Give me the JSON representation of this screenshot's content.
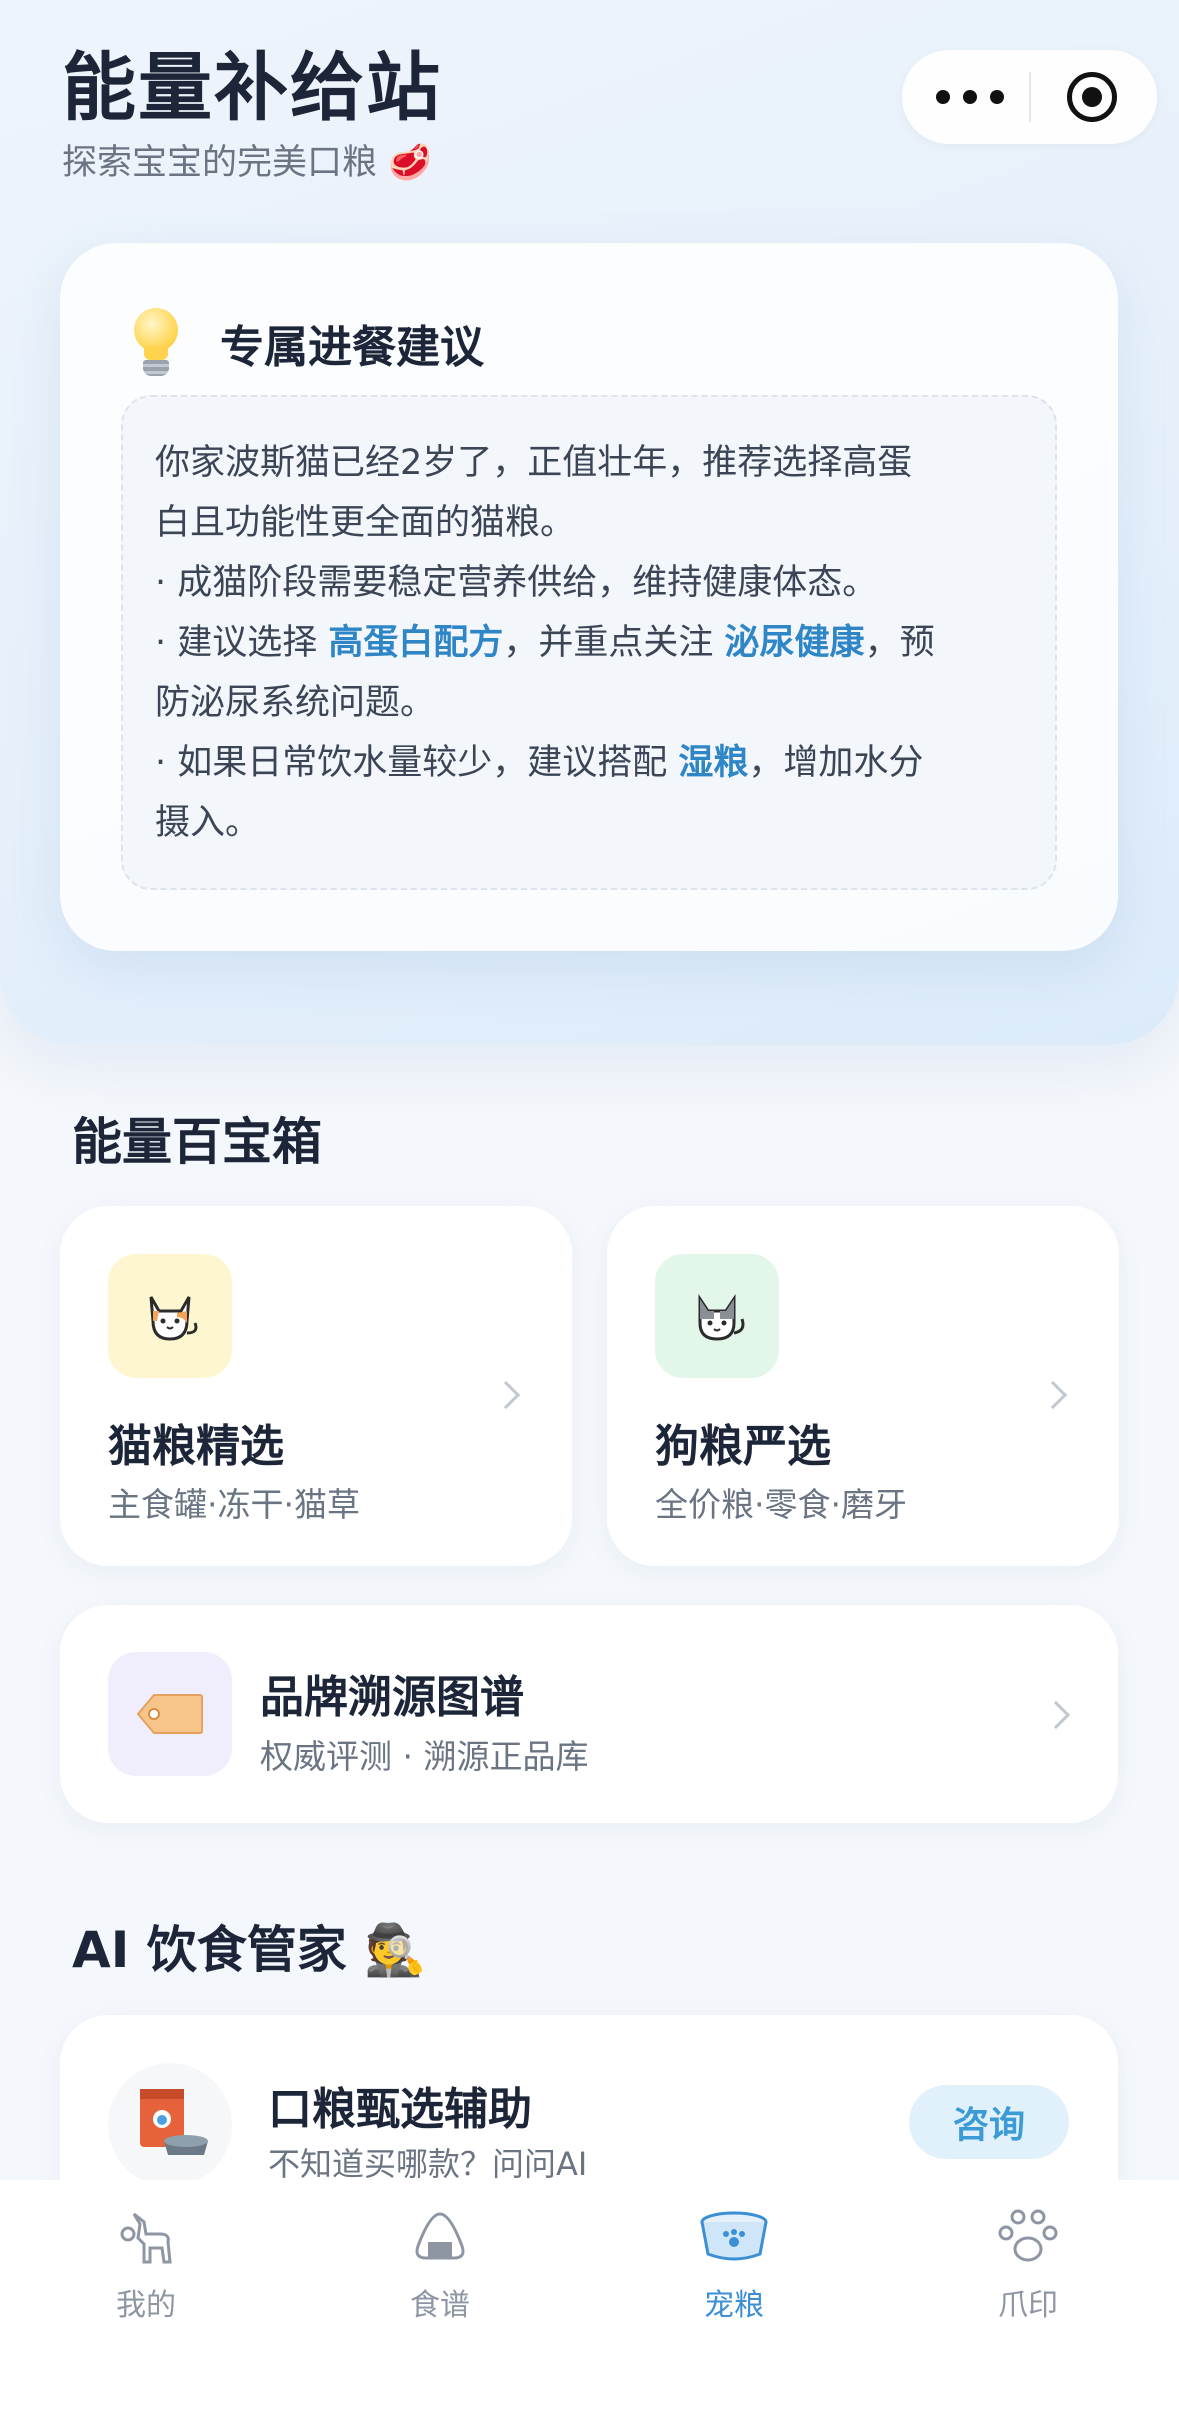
{
  "header": {
    "title": "能量补给站",
    "subtitle": "探索宝宝的完美口粮 🥩"
  },
  "capsule": {
    "more_icon": "more-dots-icon",
    "close_icon": "target-circle-icon"
  },
  "advice": {
    "title": "专属进餐建议",
    "icon": "lightbulb-icon",
    "intro_line1": "你家波斯猫已经2岁了，正值壮年，推荐选择高蛋",
    "intro_line2": "白且功能性更全面的猫粮。",
    "bullet1": "· 成猫阶段需要稳定营养供给，维持健康体态。",
    "bullet2_prefix": "· 建议选择 ",
    "bullet2_hl1": "高蛋白配方",
    "bullet2_mid": "，并重点关注 ",
    "bullet2_hl2": "泌尿健康",
    "bullet2_suffix": "，预",
    "bullet2_line2": "防泌尿系统问题。",
    "bullet3_prefix": "· 如果日常饮水量较少，建议搭配 ",
    "bullet3_hl": "湿粮",
    "bullet3_suffix": "，增加水分",
    "bullet3_line2": "摄入。",
    "highlight_color": "#2f86c7"
  },
  "toolbox": {
    "title": "能量百宝箱",
    "cat": {
      "title": "猫粮精选",
      "subtitle": "主食罐·冻干·猫草",
      "icon": "cat-icon",
      "tile_color": "#fdf6d0"
    },
    "dog": {
      "title": "狗粮严选",
      "subtitle": "全价粮·零食·磨牙",
      "icon": "dog-icon",
      "tile_color": "#e3f6ea"
    },
    "brand": {
      "title": "品牌溯源图谱",
      "subtitle": "权威评测 · 溯源正品库",
      "icon": "tag-icon"
    }
  },
  "ai": {
    "title": "AI 饮食管家 🕵️",
    "card_title": "口粮甄选辅助",
    "card_subtitle": "不知道买哪款？问问AI",
    "button": "咨询",
    "icon": "pet-food-bag-icon"
  },
  "tabbar": {
    "items": [
      {
        "label": "我的",
        "icon": "pet-profile-icon",
        "active": false
      },
      {
        "label": "食谱",
        "icon": "rice-ball-icon",
        "active": false
      },
      {
        "label": "宠粮",
        "icon": "pet-bowl-icon",
        "active": true
      },
      {
        "label": "爪印",
        "icon": "paw-print-icon",
        "active": false
      }
    ],
    "active_color": "#3c8fd4"
  }
}
